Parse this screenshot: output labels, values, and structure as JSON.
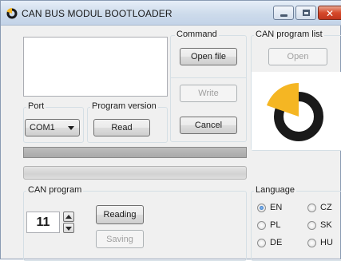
{
  "window": {
    "title": "CAN BUS MODUL BOOTLOADER",
    "close_glyph": "✕"
  },
  "command": {
    "label": "Command",
    "open_file": "Open file",
    "write": "Write",
    "cancel": "Cancel"
  },
  "port": {
    "label": "Port",
    "selected": "COM1"
  },
  "program_version": {
    "label": "Program version",
    "read": "Read"
  },
  "can_program_list": {
    "label": "CAN program list",
    "open": "Open"
  },
  "can_program": {
    "label": "CAN program",
    "number": "11",
    "reading": "Reading",
    "saving": "Saving"
  },
  "language": {
    "label": "Language",
    "options": [
      "EN",
      "CZ",
      "PL",
      "SK",
      "DE",
      "HU"
    ],
    "selected": "EN"
  },
  "colors": {
    "logo_yellow": "#f5b623",
    "logo_black": "#1a1a1a"
  }
}
